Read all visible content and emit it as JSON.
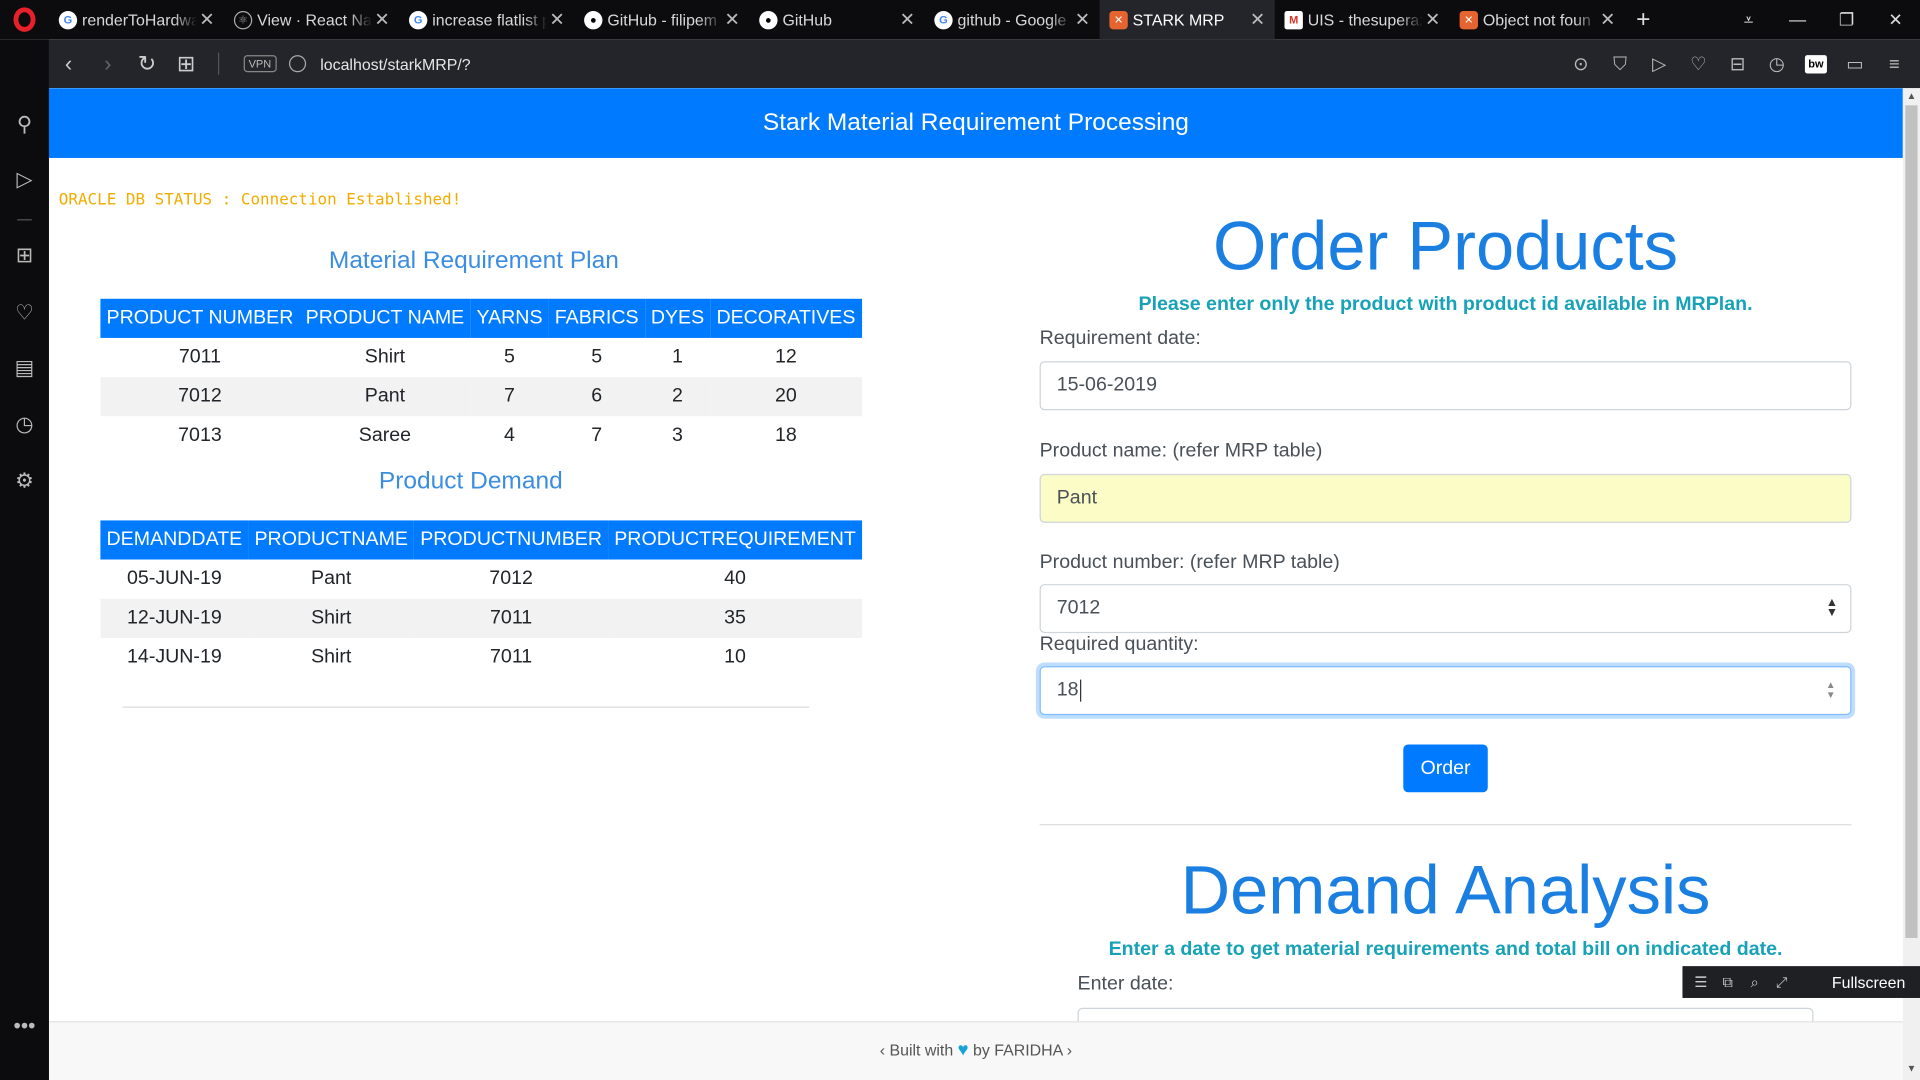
{
  "browser": {
    "tabs": [
      {
        "title": "renderToHardwa",
        "icon": "google-icon"
      },
      {
        "title": "View · React Nat",
        "icon": "react-icon"
      },
      {
        "title": "increase flatlist p",
        "icon": "google-icon"
      },
      {
        "title": "GitHub - filipem",
        "icon": "github-icon"
      },
      {
        "title": "GitHub",
        "icon": "github-icon"
      },
      {
        "title": "github - Google",
        "icon": "google-icon"
      },
      {
        "title": "STARK MRP",
        "icon": "xampp-icon"
      },
      {
        "title": "UIS - thesuperaz",
        "icon": "gmail-icon"
      },
      {
        "title": "Object not foun",
        "icon": "xampp-icon"
      }
    ],
    "vpn_label": "VPN",
    "url": "localhost/starkMRP/?"
  },
  "page": {
    "header": "Stark Material Requirement Processing",
    "db_status": "ORACLE DB STATUS : Connection Established!",
    "mrp": {
      "title": "Material Requirement Plan",
      "columns": [
        "PRODUCT NUMBER",
        "PRODUCT NAME",
        "YARNS",
        "FABRICS",
        "DYES",
        "DECORATIVES"
      ],
      "rows": [
        [
          "7011",
          "Shirt",
          "5",
          "5",
          "1",
          "12"
        ],
        [
          "7012",
          "Pant",
          "7",
          "6",
          "2",
          "20"
        ],
        [
          "7013",
          "Saree",
          "4",
          "7",
          "3",
          "18"
        ]
      ]
    },
    "demand": {
      "title": "Product Demand",
      "columns": [
        "DEMANDDATE",
        "PRODUCTNAME",
        "PRODUCTNUMBER",
        "PRODUCTREQUIREMENT"
      ],
      "rows": [
        [
          "05-JUN-19",
          "Pant",
          "7012",
          "40"
        ],
        [
          "12-JUN-19",
          "Shirt",
          "7011",
          "35"
        ],
        [
          "14-JUN-19",
          "Shirt",
          "7011",
          "10"
        ]
      ]
    },
    "order": {
      "title": "Order Products",
      "hint": "Please enter only the product with product id available in MRPlan.",
      "req_date_label": "Requirement date:",
      "req_date_value": "15-06-2019",
      "product_name_label": "Product name: (refer MRP table)",
      "product_name_value": "Pant",
      "product_number_label": "Product number: (refer MRP table)",
      "product_number_value": "7012",
      "quantity_label": "Required quantity:",
      "quantity_value": "18",
      "order_button": "Order"
    },
    "analysis": {
      "title": "Demand Analysis",
      "hint": "Enter a date to get material requirements and total bill on indicated date.",
      "date_label": "Enter date:"
    },
    "footer": {
      "prefix": "Built with",
      "suffix": "by FARIDHA"
    },
    "fullscreen_label": "Fullscreen"
  }
}
